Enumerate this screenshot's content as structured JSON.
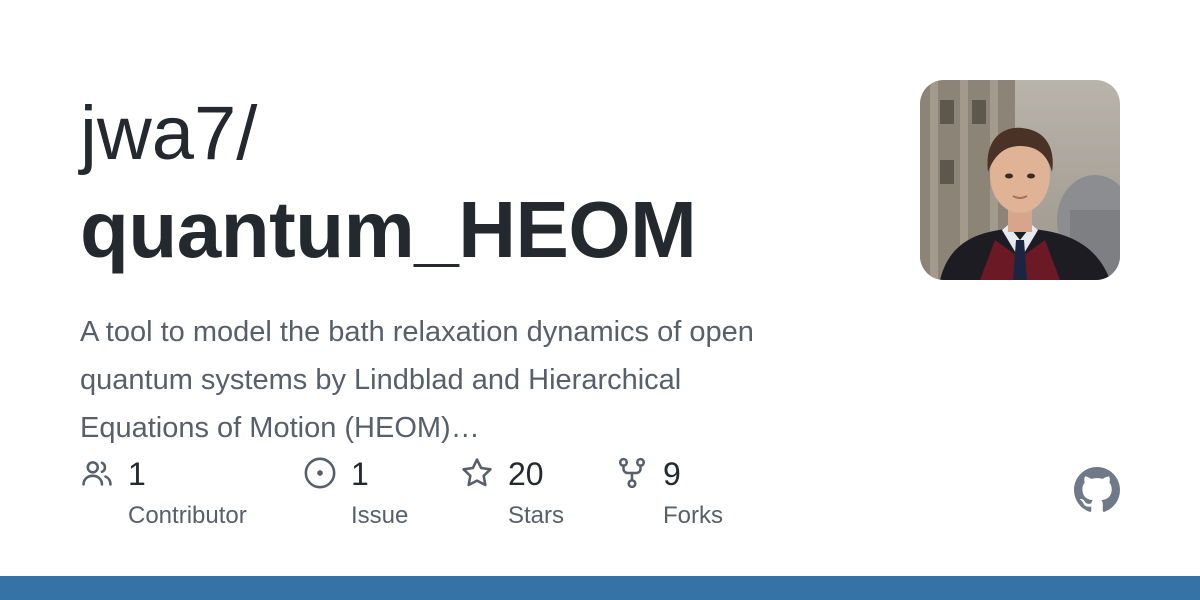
{
  "repo": {
    "owner": "jwa7/",
    "name": "quantum_HEOM",
    "description": "A tool to model the bath relaxation dynamics of open quantum systems by Lindblad and Hierarchical Equations of Motion (HEOM)…"
  },
  "stats": [
    {
      "icon": "people-icon",
      "count": "1",
      "label": "Contributor"
    },
    {
      "icon": "issue-opened-icon",
      "count": "1",
      "label": "Issue"
    },
    {
      "icon": "star-icon",
      "count": "20",
      "label": "Stars"
    },
    {
      "icon": "repo-forked-icon",
      "count": "9",
      "label": "Forks"
    }
  ],
  "colors": {
    "text_primary": "#24292f",
    "text_muted": "#57606a",
    "language_bar": "#3572A5"
  },
  "brand_icon": "github-mark-icon"
}
